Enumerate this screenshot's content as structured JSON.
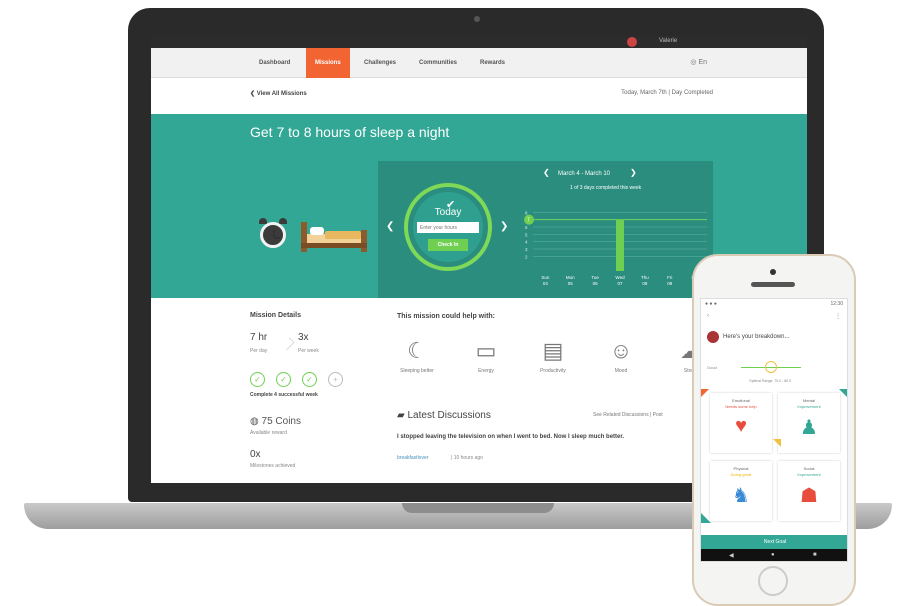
{
  "nav": {
    "tabs": [
      "Dashboard",
      "Missions",
      "Challenges",
      "Communities",
      "Rewards"
    ],
    "active_tab": "Missions",
    "user_name": "Valerie",
    "util": "En"
  },
  "crumb": {
    "back": "View All Missions",
    "date": "Today, March 7th | Day Completed"
  },
  "mission": {
    "title": "Get 7 to 8 hours of sleep a night",
    "today_label": "Today",
    "hours_placeholder": "Enter your hours",
    "checkin_label": "Check In",
    "range_label": "March 4 - March 10",
    "range_sub": "1 of 3 days completed this week"
  },
  "chart_data": {
    "type": "bar",
    "categories": [
      "Sun 04",
      "Mon 05",
      "Tue 06",
      "Wed 07",
      "Thu 08",
      "Fri 09",
      "Sat 10"
    ],
    "values": [
      0,
      0,
      0,
      7,
      0,
      0,
      0
    ],
    "target": 7,
    "ylim": [
      0,
      9
    ],
    "yticks": [
      "8",
      "7",
      "6",
      "5",
      "4",
      "3",
      "2"
    ]
  },
  "details": {
    "title": "Mission Details",
    "per_day_value": "7 hr",
    "per_day_label": "Per day",
    "per_week_value": "3x",
    "per_week_label": "Per week",
    "progress_caption": "Complete 4 successful week",
    "weeks_completed": 3,
    "weeks_total": 4,
    "coins": "75 Coins",
    "coins_label": "Available reward",
    "achieved_value": "0x",
    "achieved_label": "Milestones achieved"
  },
  "help": {
    "title": "This mission could help with:",
    "items": [
      "Sleeping better",
      "Energy",
      "Productivity",
      "Mood",
      "Stress"
    ]
  },
  "discussion": {
    "title": "Latest Discussions",
    "see_all": "See Related Discussions | Post",
    "post": "I stopped leaving the television on when I went to bed. Now I sleep much better.",
    "author": "breakfastlover",
    "time": "| 10 hours ago"
  },
  "phone": {
    "time": "12:30",
    "heading": "Here's your breakdown...",
    "axis_label": "Good",
    "axis_sub": "Optimal Range: 70.0 - 80.0",
    "cards": [
      {
        "title": "Emotional",
        "status": "Needs some help",
        "status_color": "#e84c3d"
      },
      {
        "title": "Mental",
        "status": "Improvement",
        "status_color": "#32a795"
      },
      {
        "title": "Physical",
        "status": "Doing great",
        "status_color": "#f0b400"
      },
      {
        "title": "Social",
        "status": "Improvement",
        "status_color": "#32a795"
      }
    ],
    "button": "Next Goal"
  },
  "colors": {
    "accent": "#f26432",
    "teal": "#32a795",
    "green": "#6fcf51"
  }
}
